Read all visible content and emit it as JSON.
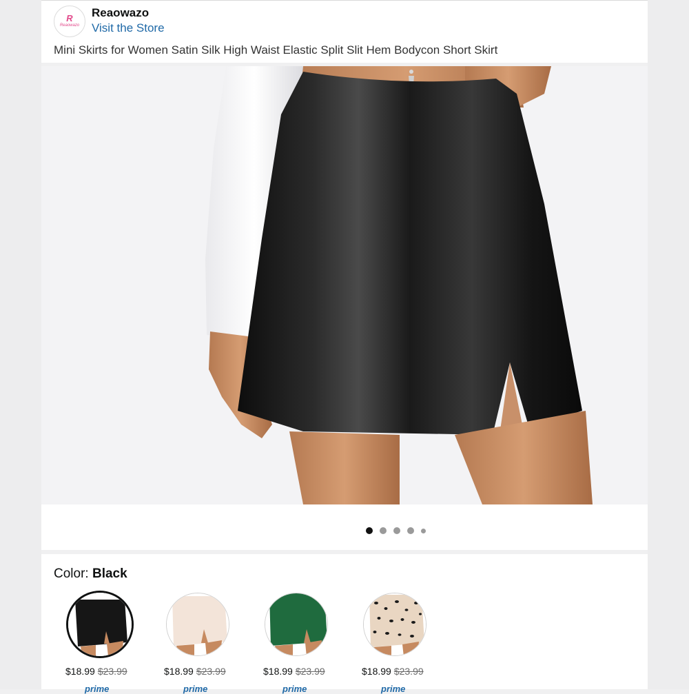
{
  "store": {
    "name": "Reaowazo",
    "logo_monogram": "R",
    "logo_wordmark": "Reaowazo",
    "visit_label": "Visit the Store"
  },
  "product": {
    "title": "Mini Skirts for Women Satin Silk High Waist Elastic Split Slit Hem Bodycon Short Skirt",
    "image_count": 5,
    "active_image": 1
  },
  "color": {
    "label": "Color: ",
    "selected": "Black",
    "options": [
      {
        "name": "black",
        "color": "#141414",
        "price": "$18.99",
        "list_price": "$23.99",
        "prime": "prime",
        "selected": true
      },
      {
        "name": "champagne",
        "color": "#f2e3d8",
        "price": "$18.99",
        "list_price": "$23.99",
        "prime": "prime",
        "selected": false
      },
      {
        "name": "green",
        "color": "#1f6b3e",
        "price": "$18.99",
        "list_price": "$23.99",
        "prime": "prime",
        "selected": false
      },
      {
        "name": "leopard",
        "color": "#e8d5c0",
        "price": "$18.99",
        "list_price": "$23.99",
        "prime": "prime",
        "selected": false
      }
    ]
  },
  "colors": {
    "link": "#1f69a7",
    "background": "#f0f0f1",
    "card": "#ffffff",
    "brand_pink": "#e2498b"
  }
}
